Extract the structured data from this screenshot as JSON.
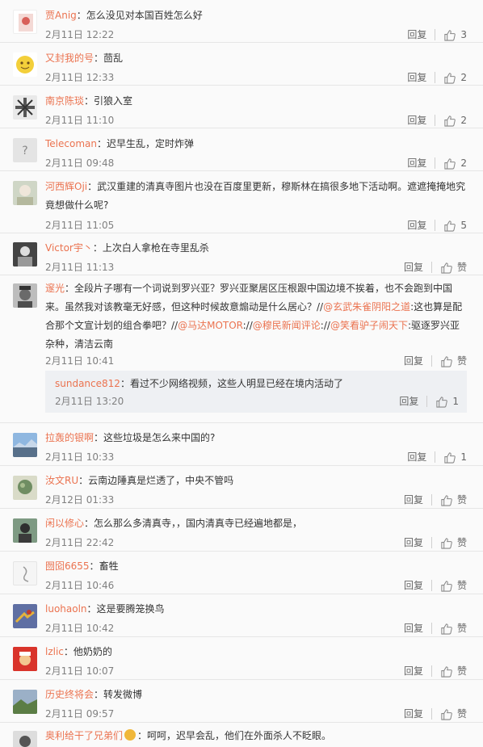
{
  "comments": [
    {
      "user": "贾Anig",
      "text": "怎么没见对本国百姓怎么好",
      "time": "2月11日 12:22",
      "likes": "3"
    },
    {
      "user": "又封我的号",
      "text": "茴乱",
      "time": "2月11日 12:33",
      "likes": "2"
    },
    {
      "user": "南京陈琰",
      "text": "引狼入室",
      "time": "2月11日 11:10",
      "likes": "2"
    },
    {
      "user": "Telecoman",
      "text": "迟早生乱，定时炸弹",
      "time": "2月11日 09:48",
      "likes": "2"
    },
    {
      "user": "河西辉Oji",
      "text_lines": [
        "武汉重建的清真寺图片也没在百度里更新，穆斯林在搞很多地下活动啊。遮遮掩掩地究",
        "竟想做什么呢?"
      ],
      "time": "2月11日 11:05",
      "likes": "5"
    },
    {
      "user": "Victor宇丶",
      "text": "上次白人拿枪在寺里乱杀",
      "time": "2月11日 11:13",
      "likes": "赞"
    },
    {
      "user": "邃光",
      "lines": [
        "全段片子哪有一个词说到罗兴亚？罗兴亚聚居区压根跟中国边境不挨着，也不会跑到中国",
        "来。虽然我对该教毫无好感，但这种时候故意煽动是什么居心？//",
        "@玄武朱雀阴阳之道",
        ":这也算是配",
        "合那个文宣计划的组合拳吧？//",
        "@马达MOTOR",
        "://",
        "@穆民新闻评论",
        "://",
        "@笑看驴子闹天下",
        ":驱逐罗兴亚",
        "杂种，清洁云南"
      ],
      "time": "2月11日 10:41",
      "likes": "赞"
    },
    {
      "user": "拉轰的银啊",
      "text": "这些垃圾是怎么来中国的?",
      "time": "2月11日 10:33",
      "likes": "1"
    },
    {
      "user": "汝文RU",
      "text": "云南边陲真是烂透了，中央不管吗",
      "time": "2月12日 01:33",
      "likes": "赞"
    },
    {
      "user": "闲以修心",
      "text": "怎么那么多清真寺，，国内清真寺已经遍地都是，",
      "time": "2月11日 22:42",
      "likes": "赞"
    },
    {
      "user": "囫囵6655",
      "text": "畜牲",
      "time": "2月11日 10:46",
      "likes": "赞"
    },
    {
      "user": "luohaoln",
      "text": "这是要腾笼换鸟",
      "time": "2月11日 10:42",
      "likes": "赞"
    },
    {
      "user": "lzlic",
      "text": "他奶奶的",
      "time": "2月11日 10:07",
      "likes": "赞"
    },
    {
      "user": "历史终将会",
      "text": "转发微博",
      "time": "2月11日 09:57",
      "likes": "赞"
    },
    {
      "user": "奥利给干了兄弟们",
      "text": "呵呵，迟早会乱，他们在外面杀人不眨眼。",
      "time": "",
      "likes": ""
    }
  ],
  "subreply": {
    "user": "sundance812",
    "text": "看过不少网络视频，这些人明显已经在境内活动了",
    "time": "2月11日 13:20",
    "likes": "1"
  },
  "labels": {
    "reply": "回复"
  },
  "colors": {
    "username": "#eb7350",
    "meta": "#808080"
  }
}
